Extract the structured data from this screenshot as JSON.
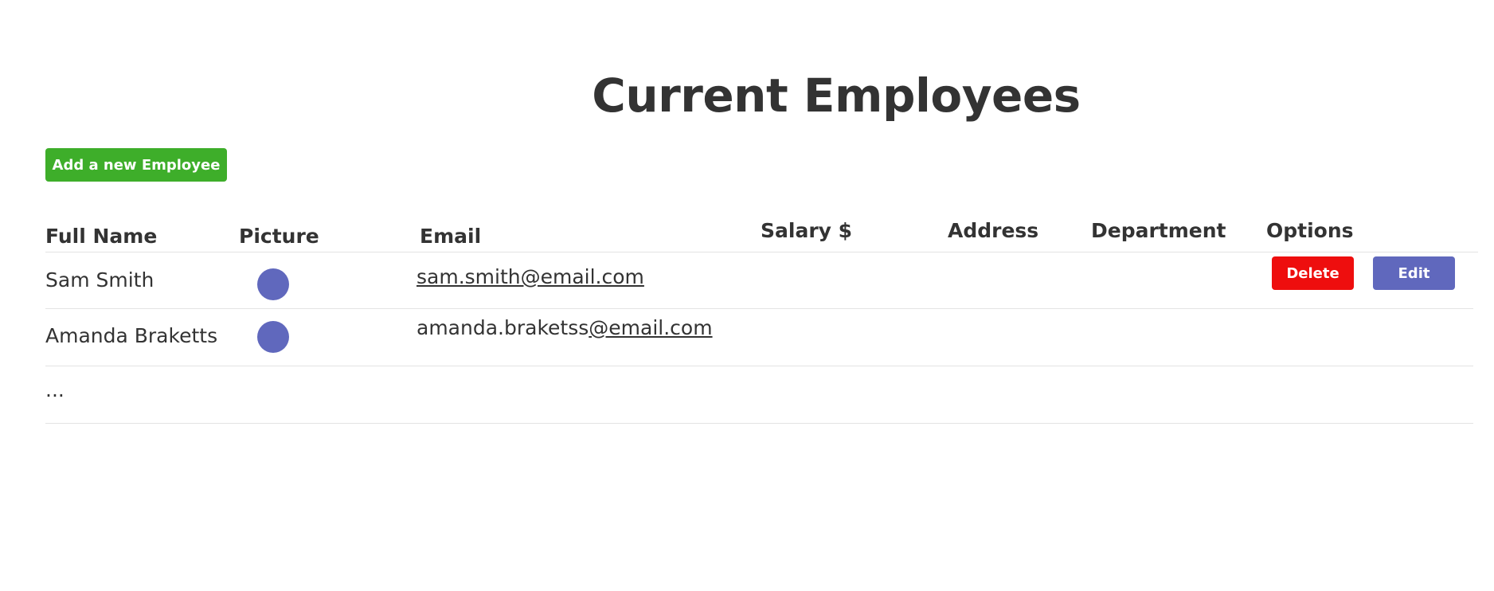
{
  "page": {
    "title": "Current Employees"
  },
  "toolbar": {
    "add_label": "Add a new Employee"
  },
  "table": {
    "headers": {
      "full_name": "Full Name",
      "picture": "Picture",
      "email": "Email",
      "salary": "Salary $",
      "address": "Address",
      "department": "Department",
      "options": "Options"
    },
    "rows": [
      {
        "full_name": "Sam Smith",
        "email": "sam.smith@email.com",
        "delete_label": "Delete",
        "edit_label": "Edit"
      },
      {
        "full_name": "Amanda Braketts",
        "email_local": "amanda.braketss",
        "email_domain": "@email.com"
      }
    ],
    "more": "..."
  },
  "colors": {
    "add_button": "#3eae2a",
    "delete_button": "#ee0e0e",
    "edit_button": "#6068bd",
    "avatar": "#6068bd",
    "text": "#333333"
  },
  "icons": {
    "avatar": "avatar-placeholder-circle"
  }
}
